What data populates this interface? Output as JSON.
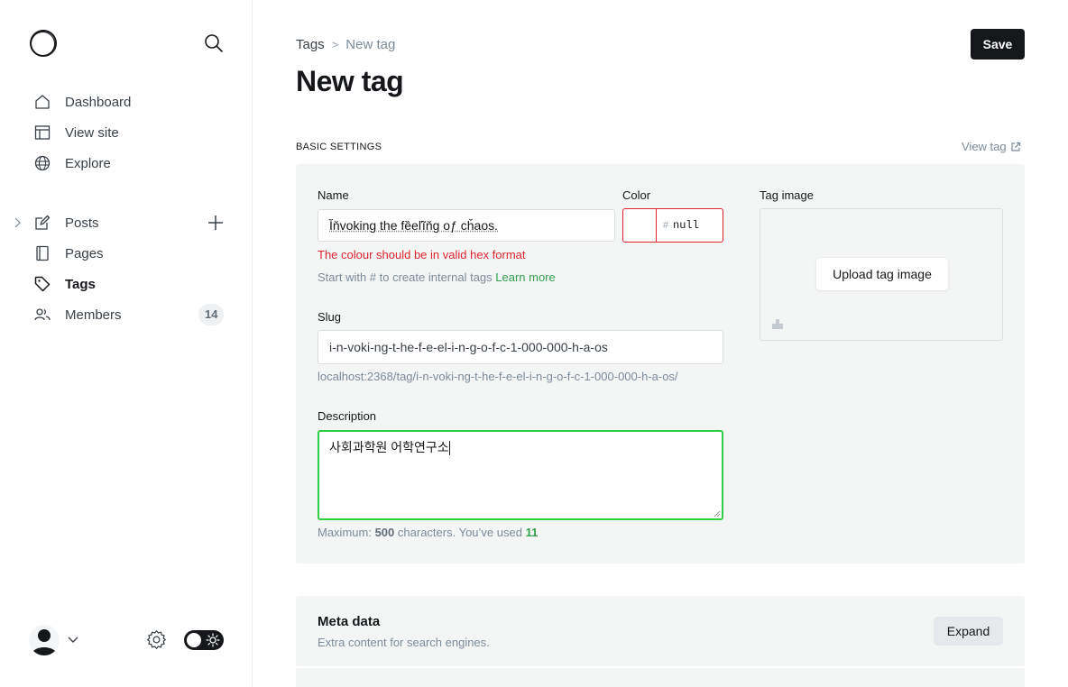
{
  "sidebar": {
    "items": [
      {
        "label": "Dashboard",
        "icon": "house-icon"
      },
      {
        "label": "View site",
        "icon": "layout-icon"
      },
      {
        "label": "Explore",
        "icon": "globe-icon"
      },
      {
        "label": "Posts",
        "icon": "pencil-square-icon"
      },
      {
        "label": "Pages",
        "icon": "page-icon"
      },
      {
        "label": "Tags",
        "icon": "tag-icon",
        "active": true
      },
      {
        "label": "Members",
        "icon": "members-icon",
        "badge": "14"
      }
    ]
  },
  "header": {
    "breadcrumb_parent": "Tags",
    "breadcrumb_separator": ">",
    "breadcrumb_current": "New tag",
    "title": "New tag",
    "save_label": "Save"
  },
  "basic": {
    "section_label": "BASIC SETTINGS",
    "view_tag_label": "View tag",
    "name_label": "Name",
    "name_value": "Ĭňvoking the fȅeľĩňg oƒ cȟaos.",
    "color_label": "Color",
    "color_hash": "#",
    "color_value": "null",
    "color_error": "The colour should be in valid hex format",
    "name_hint": "Start with # to create internal tags",
    "learn_more": "Learn more",
    "slug_label": "Slug",
    "slug_value": "i-n-voki-ng-t-he-f-e-el-i-n-g-o-f-c-1-000-000-h-a-os",
    "slug_url": "localhost:2368/tag/i-n-voki-ng-t-he-f-e-el-i-n-g-o-f-c-1-000-000-h-a-os/",
    "description_label": "Description",
    "description_value": "사회과학원 어학연구소",
    "counter_prefix": "Maximum:",
    "counter_max": "500",
    "counter_mid": "characters. You’ve used",
    "counter_used": "11",
    "tag_image_label": "Tag image",
    "upload_label": "Upload tag image"
  },
  "meta": {
    "title": "Meta data",
    "subtitle": "Extra content for search engines.",
    "expand_label": "Expand"
  },
  "colors": {
    "accent_green": "#30cf43",
    "error_red": "#e0242e",
    "dark": "#15171a"
  }
}
